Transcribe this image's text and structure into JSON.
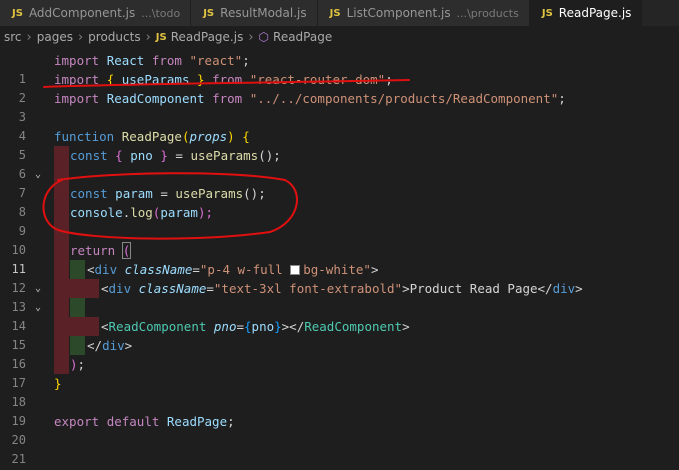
{
  "tabs": [
    {
      "label": "AddComponent.js",
      "hint": "...\\todo",
      "active": false
    },
    {
      "label": "ResultModal.js",
      "hint": "",
      "active": false
    },
    {
      "label": "ListComponent.js",
      "hint": "...\\products",
      "active": false
    },
    {
      "label": "ReadPage.js",
      "hint": "",
      "active": true
    }
  ],
  "tab_icon": "JS",
  "breadcrumb": {
    "items": [
      "src",
      "pages",
      "products",
      "ReadPage.js",
      "ReadPage"
    ],
    "separator": "›"
  },
  "editor": {
    "current_line": 11,
    "line_numbers": [
      "1",
      "2",
      "3",
      "4",
      "5",
      "6",
      "7",
      "8",
      "9",
      "10",
      "11",
      "12",
      "13",
      "14",
      "15",
      "16",
      "17",
      "18",
      "19",
      "20",
      "21"
    ],
    "code": {
      "l1": {
        "a": "import",
        "b": "React",
        "c": "from",
        "d": "\"react\"",
        "e": ";"
      },
      "l2": {
        "a": "import",
        "b": "{",
        "c": "useParams",
        "d": "}",
        "e": "from",
        "f": "\"react-router-dom\"",
        "g": ";"
      },
      "l3": {
        "a": "import",
        "b": "ReadComponent",
        "c": "from",
        "d": "\"../../components/products/ReadComponent\"",
        "e": ";"
      },
      "l5": {
        "a": "function",
        "b": "ReadPage",
        "c": "(",
        "d": "props",
        "e": ")",
        "f": "{"
      },
      "l6": {
        "a": "const",
        "b": "{",
        "c": "pno",
        "d": "}",
        "e": "=",
        "f": "useParams",
        "g": "();"
      },
      "l8": {
        "a": "const",
        "b": "param",
        "c": "=",
        "d": "useParams",
        "e": "();"
      },
      "l9": {
        "a": "console",
        "b": ".",
        "c": "log",
        "d": "(",
        "e": "param",
        "f": ");"
      },
      "l11": {
        "a": "return",
        "b": "("
      },
      "l12": {
        "a": "<",
        "b": "div",
        "c": "className",
        "d": "=",
        "e": "\"p-4 w-full ",
        "f": "bg-white\"",
        "g": ">"
      },
      "l13": {
        "a": "<",
        "b": "div",
        "c": "className",
        "d": "=",
        "e": "\"text-3xl font-extrabold\"",
        "f": ">",
        "g": "Product Read Page",
        "h": "</",
        "i": "div",
        "j": ">"
      },
      "l15": {
        "a": "<",
        "b": "ReadComponent",
        "c": "pno",
        "d": "=",
        "e": "{",
        "f": "pno",
        "g": "}",
        "h": "></",
        "i": "ReadComponent",
        "j": ">"
      },
      "l16": {
        "a": "</",
        "b": "div",
        "c": ">"
      },
      "l17": {
        "a": ")",
        "b": ";"
      },
      "l18": {
        "a": "}"
      },
      "l20": {
        "a": "export",
        "b": "default",
        "c": "ReadPage",
        "d": ";"
      }
    }
  },
  "colors": {
    "annotation": "#e01010",
    "background": "#1e1e1e",
    "keyword": "#c586c0",
    "string": "#ce9178"
  }
}
